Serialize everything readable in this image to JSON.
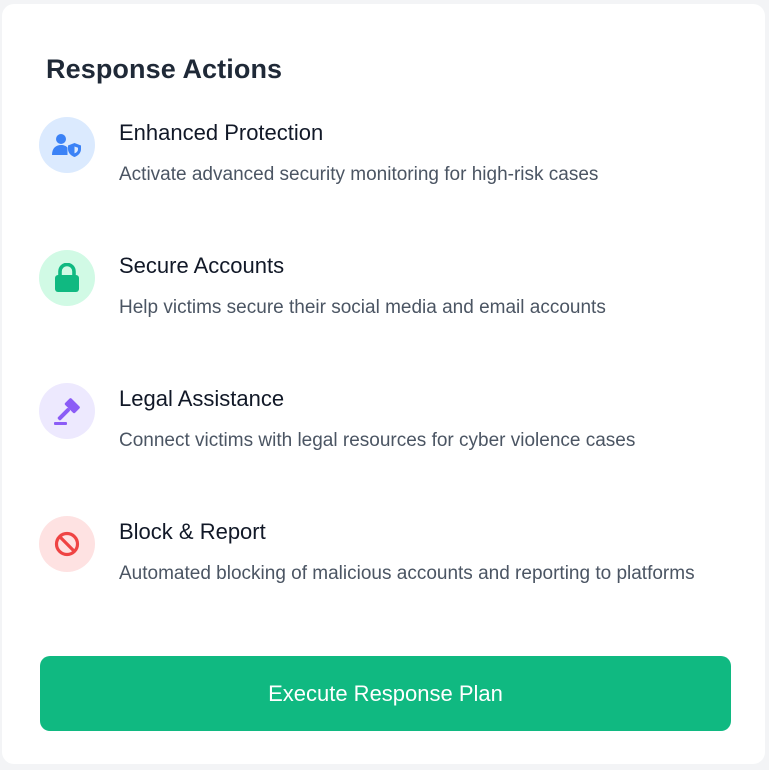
{
  "panel": {
    "title": "Response Actions"
  },
  "actions": [
    {
      "title": "Enhanced Protection",
      "description": "Activate advanced security monitoring for high-risk cases",
      "icon": "user-shield-icon",
      "icon_color": "#3b82f6",
      "icon_bg": "#dbeafe"
    },
    {
      "title": "Secure Accounts",
      "description": "Help victims secure their social media and email accounts",
      "icon": "lock-icon",
      "icon_color": "#10b981",
      "icon_bg": "#d1fae5"
    },
    {
      "title": "Legal Assistance",
      "description": "Connect victims with legal resources for cyber violence cases",
      "icon": "gavel-icon",
      "icon_color": "#8b5cf6",
      "icon_bg": "#ede9fe"
    },
    {
      "title": "Block & Report",
      "description": "Automated blocking of malicious accounts and reporting to platforms",
      "icon": "ban-icon",
      "icon_color": "#ef4444",
      "icon_bg": "#fee2e2"
    }
  ],
  "cta": {
    "label": "Execute Response Plan",
    "color": "#10b981"
  }
}
